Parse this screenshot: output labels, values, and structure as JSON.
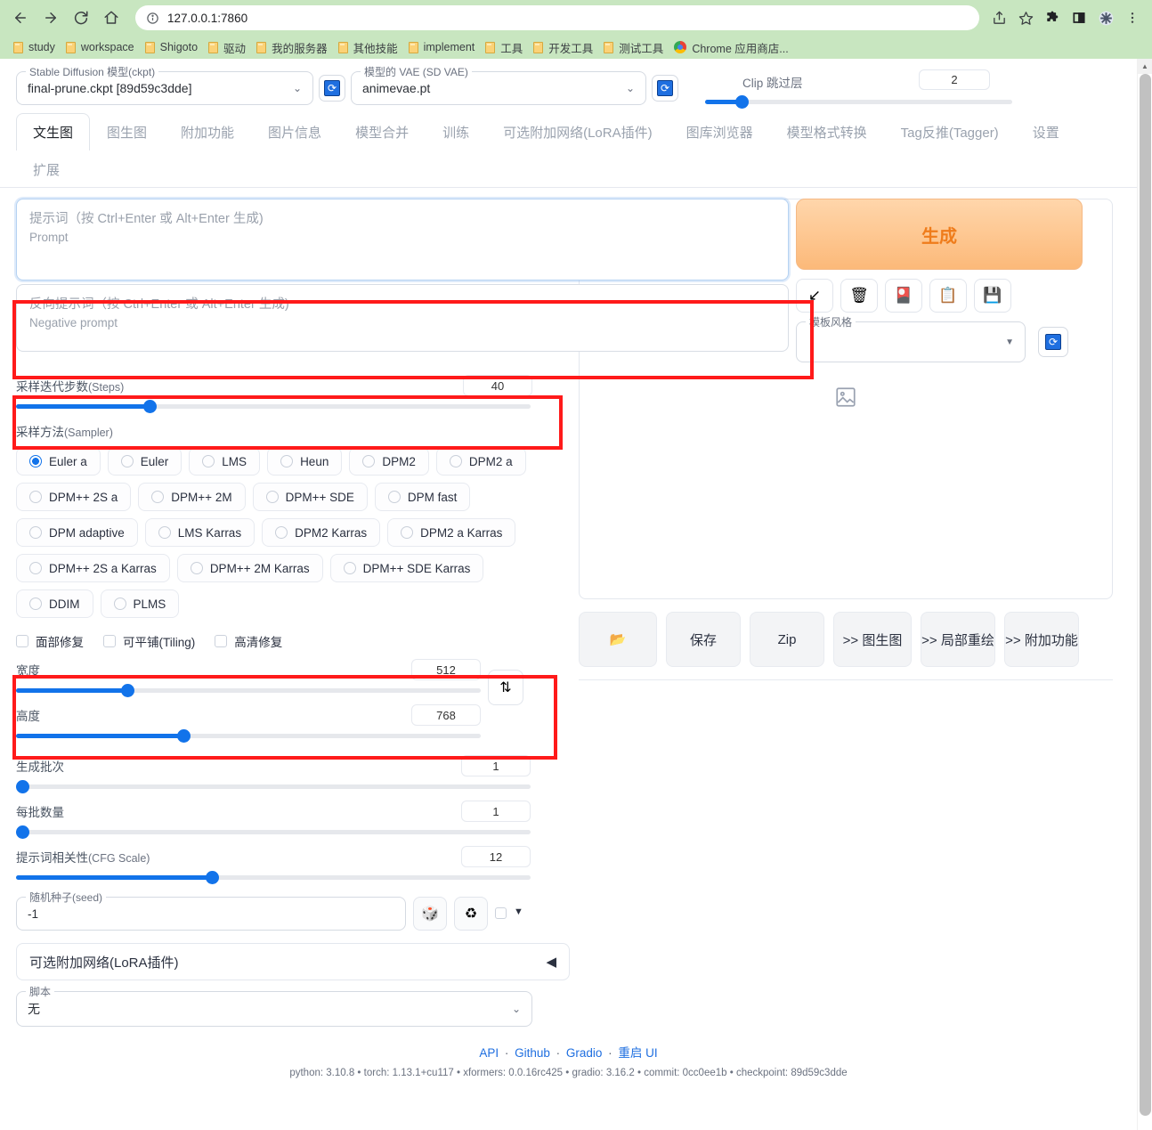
{
  "browser": {
    "url": "127.0.0.1:7860",
    "nav": {
      "back": "back-arrow",
      "forward": "forward-arrow",
      "reload": "reload",
      "home": "home"
    },
    "bookmarks": [
      {
        "label": "study",
        "icon": "folder-icon"
      },
      {
        "label": "workspace",
        "icon": "folder-icon"
      },
      {
        "label": "Shigoto",
        "icon": "folder-icon"
      },
      {
        "label": "驱动",
        "icon": "folder-icon"
      },
      {
        "label": "我的服务器",
        "icon": "folder-icon"
      },
      {
        "label": "其他技能",
        "icon": "folder-icon"
      },
      {
        "label": "implement",
        "icon": "folder-icon"
      },
      {
        "label": "工具",
        "icon": "folder-icon"
      },
      {
        "label": "开发工具",
        "icon": "folder-icon"
      },
      {
        "label": "测试工具",
        "icon": "folder-icon"
      },
      {
        "label": "Chrome 应用商店...",
        "icon": "chrome-web-store-icon"
      }
    ],
    "toolbar_icons": [
      "share-icon",
      "star-icon",
      "extensions-icon",
      "sidebar-icon",
      "profile-icon",
      "menu-icon"
    ]
  },
  "topbar": {
    "ckpt_label": "Stable Diffusion 模型(ckpt)",
    "ckpt_value": "final-prune.ckpt [89d59c3dde]",
    "vae_label": "模型的 VAE (SD VAE)",
    "vae_value": "animevae.pt",
    "clip_label": "Clip 跳过层",
    "clip_value": "2",
    "clip_fill_pct": 12
  },
  "tabs": [
    {
      "label": "文生图",
      "active": true
    },
    {
      "label": "图生图",
      "active": false
    },
    {
      "label": "附加功能",
      "active": false
    },
    {
      "label": "图片信息",
      "active": false
    },
    {
      "label": "模型合并",
      "active": false
    },
    {
      "label": "训练",
      "active": false
    },
    {
      "label": "可选附加网络(LoRA插件)",
      "active": false
    },
    {
      "label": "图库浏览器",
      "active": false
    },
    {
      "label": "模型格式转换",
      "active": false
    },
    {
      "label": "Tag反推(Tagger)",
      "active": false
    },
    {
      "label": "设置",
      "active": false
    },
    {
      "label": "扩展",
      "active": false
    }
  ],
  "prompt": {
    "positive_placeholder_cn": "提示词（按 Ctrl+Enter 或 Alt+Enter 生成)",
    "positive_placeholder_en": "Prompt",
    "positive_value": "",
    "negative_placeholder_cn": "反向提示词（按 Ctrl+Enter 或 Alt+Enter 生成)",
    "negative_placeholder_en": "Negative prompt",
    "negative_value": ""
  },
  "generate": {
    "label": "生成",
    "color": "#ef7c1b",
    "tool_icons": [
      {
        "name": "arrow-down-left-icon",
        "glyph": "↙"
      },
      {
        "name": "trash-icon",
        "glyph": "🗑"
      },
      {
        "name": "extra-networks-icon",
        "glyph": "🎴"
      },
      {
        "name": "clipboard-icon",
        "glyph": "📋"
      },
      {
        "name": "save-style-icon",
        "glyph": "💾"
      }
    ],
    "styles_label": "模板风格",
    "styles_value": ""
  },
  "params": {
    "steps": {
      "label_cn": "采样迭代步数",
      "label_en": "(Steps)",
      "value": "40",
      "fill_pct": 26
    },
    "sampler_label_cn": "采样方法",
    "sampler_label_en": "(Sampler)",
    "samplers": [
      {
        "label": "Euler a",
        "selected": true
      },
      {
        "label": "Euler",
        "selected": false
      },
      {
        "label": "LMS",
        "selected": false
      },
      {
        "label": "Heun",
        "selected": false
      },
      {
        "label": "DPM2",
        "selected": false
      },
      {
        "label": "DPM2 a",
        "selected": false
      },
      {
        "label": "DPM++ 2S a",
        "selected": false
      },
      {
        "label": "DPM++ 2M",
        "selected": false
      },
      {
        "label": "DPM++ SDE",
        "selected": false
      },
      {
        "label": "DPM fast",
        "selected": false
      },
      {
        "label": "DPM adaptive",
        "selected": false
      },
      {
        "label": "LMS Karras",
        "selected": false
      },
      {
        "label": "DPM2 Karras",
        "selected": false
      },
      {
        "label": "DPM2 a Karras",
        "selected": false
      },
      {
        "label": "DPM++ 2S a Karras",
        "selected": false
      },
      {
        "label": "DPM++ 2M Karras",
        "selected": false
      },
      {
        "label": "DPM++ SDE Karras",
        "selected": false
      },
      {
        "label": "DDIM",
        "selected": false
      },
      {
        "label": "PLMS",
        "selected": false
      }
    ],
    "checkboxes": [
      {
        "label": "面部修复",
        "checked": false
      },
      {
        "label": "可平铺(Tiling)",
        "checked": false
      },
      {
        "label": "高清修复",
        "checked": false
      }
    ],
    "width": {
      "label": "宽度",
      "value": "512",
      "fill_pct": 24
    },
    "height": {
      "label": "高度",
      "value": "768",
      "fill_pct": 36
    },
    "swap_icon": "swap-vertical-icon",
    "batch_count": {
      "label": "生成批次",
      "value": "1",
      "fill_pct": 0
    },
    "batch_size": {
      "label": "每批数量",
      "value": "1",
      "fill_pct": 0
    },
    "cfg_scale": {
      "label_cn": "提示词相关性",
      "label_en": "(CFG Scale)",
      "value": "12",
      "fill_pct": 38
    },
    "seed": {
      "label_cn": "随机种子",
      "label_en": "(seed)",
      "value": "-1",
      "dice_icon": "dice-icon",
      "recycle_icon": "recycle-icon",
      "extra_checked": false,
      "extra_caret": "▼"
    },
    "lora_accordion": {
      "label": "可选附加网络(LoRA插件)",
      "caret": "◀"
    },
    "script": {
      "label": "脚本",
      "value": "无"
    }
  },
  "output": {
    "placeholder_icon": "image-placeholder-icon",
    "buttons": [
      {
        "label": "",
        "icon": "folder-open-icon"
      },
      {
        "label": "保存",
        "icon": ""
      },
      {
        "label": "Zip",
        "icon": ""
      },
      {
        "label": ">> 图生图",
        "icon": ""
      },
      {
        "label": ">> 局部重绘",
        "icon": ""
      },
      {
        "label": ">> 附加功能",
        "icon": ""
      }
    ]
  },
  "footer": {
    "links": [
      "API",
      "Github",
      "Gradio",
      "重启 UI"
    ],
    "separator": "·",
    "version": "python: 3.10.8  •  torch: 1.13.1+cu117  •  xformers: 0.0.16rc425  •  gradio: 3.16.2  •  commit: 0cc0ee1b  •  checkpoint: 89d59c3dde"
  },
  "annotations": {
    "highlight_color": "#ff1a1a",
    "boxes": [
      "negative-prompt-region",
      "steps-region",
      "width-height-region"
    ]
  }
}
